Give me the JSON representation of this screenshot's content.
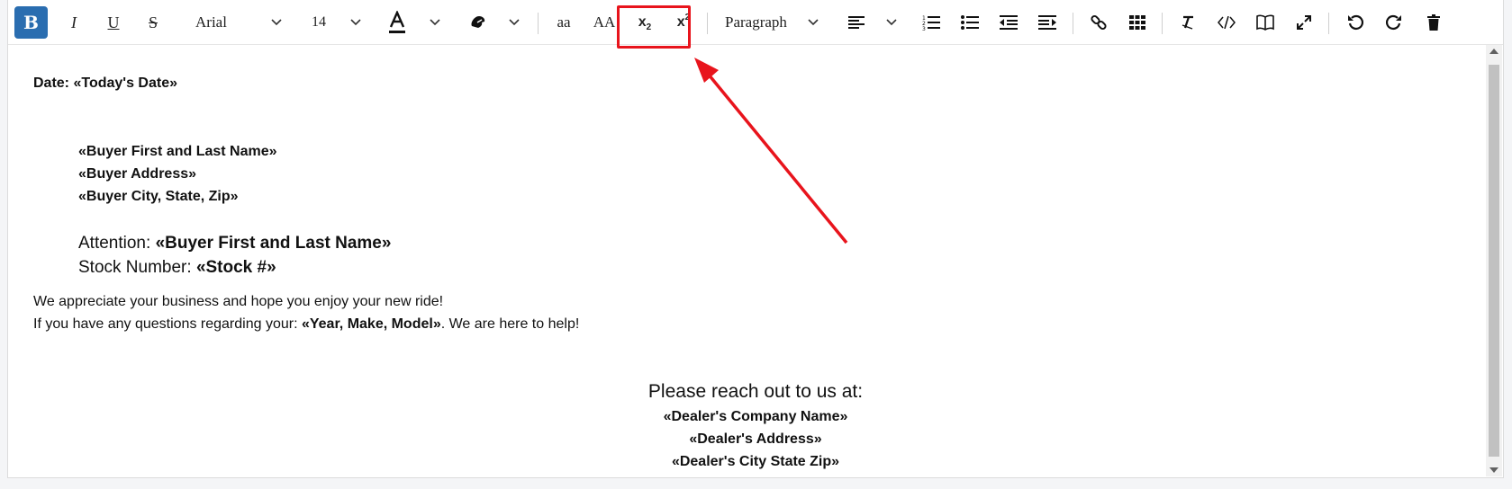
{
  "toolbar": {
    "bold_label": "B",
    "italic_label": "I",
    "underline_label": "U",
    "strike_label": "S",
    "font_family": "Arial",
    "font_size": "14",
    "lowercase_label": "aa",
    "uppercase_label": "AA",
    "subscript_label": "x",
    "subscript_mark": "2",
    "superscript_label": "x",
    "superscript_mark": "2",
    "block_format": "Paragraph",
    "icons": [
      "bold",
      "italic-icon",
      "underline-icon",
      "strikethrough-icon",
      "font-color-icon",
      "highlight-color-icon",
      "align-left-icon",
      "numbered-list-icon",
      "bullet-list-icon",
      "outdent-icon",
      "indent-icon",
      "link-icon",
      "table-icon",
      "clear-format-icon",
      "code-view-icon",
      "preview-icon",
      "fullscreen-icon",
      "undo-icon",
      "redo-icon",
      "trash-icon"
    ]
  },
  "document": {
    "date_label": "Date: «Today's Date»",
    "buyer_name": "«Buyer First and Last Name»",
    "buyer_address": "«Buyer Address»",
    "buyer_city": "«Buyer City, State, Zip»",
    "attention_prefix": "Attention: ",
    "attention_value": "«Buyer First and Last Name»",
    "stock_prefix": "Stock Number: ",
    "stock_value": "«Stock #»",
    "para1": "We appreciate your business and hope you enjoy your new ride!",
    "para2_prefix": "If you have any questions regarding your: ",
    "para2_value": "«Year, Make, Model»",
    "para2_suffix": ". We are here to help!",
    "reach_out": "Please reach out to us at:",
    "dealer_name": "«Dealer's Company Name»",
    "dealer_address": "«Dealer's Address»",
    "dealer_city": "«Dealer's City State Zip»"
  },
  "colors": {
    "bold_button_bg": "#2a6db0",
    "annotation": "#e8141c"
  }
}
